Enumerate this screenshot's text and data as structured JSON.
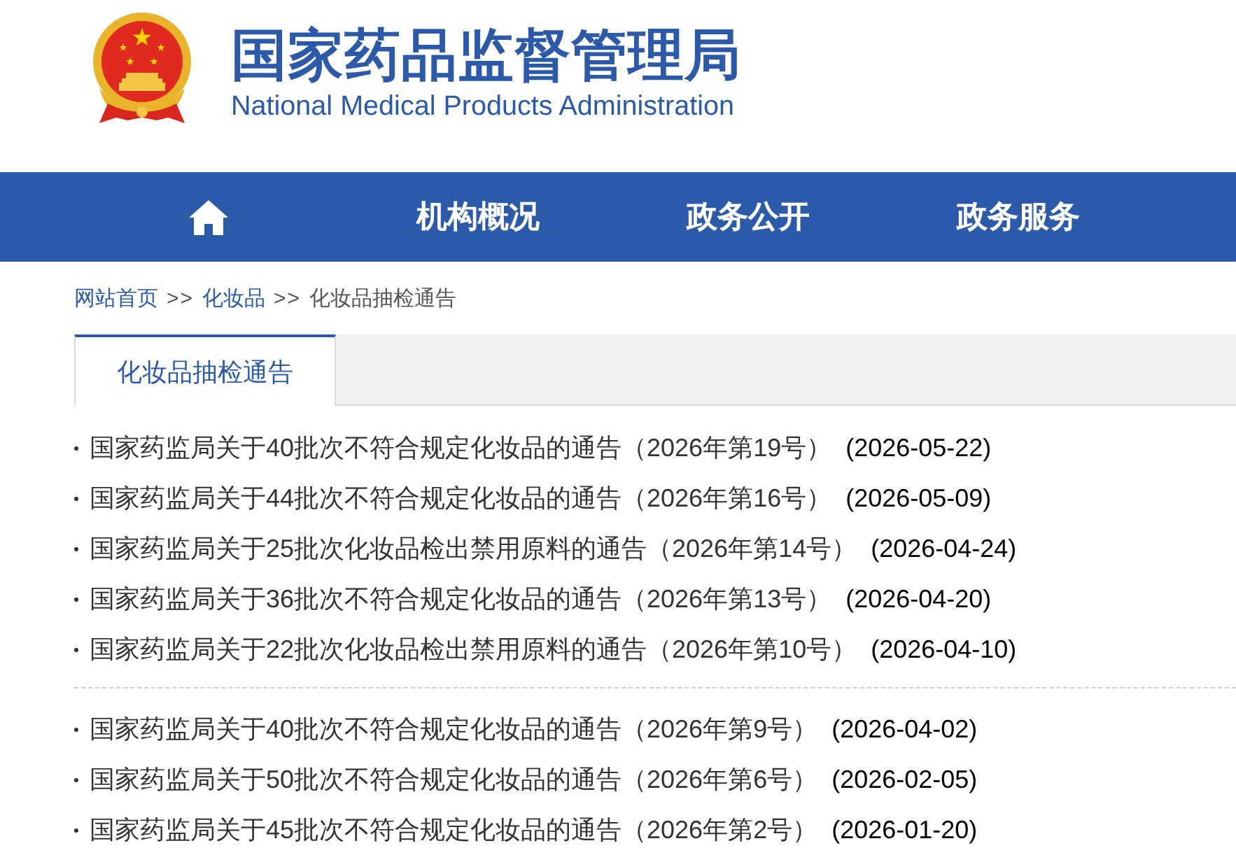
{
  "header": {
    "title": "国家药品监督管理局",
    "subtitle": "National Medical Products Administration"
  },
  "nav": [
    {
      "kind": "home"
    },
    {
      "kind": "text",
      "label": "机构概况"
    },
    {
      "kind": "text",
      "label": "政务公开"
    },
    {
      "kind": "text",
      "label": "政务服务"
    }
  ],
  "breadcrumb": [
    {
      "kind": "link",
      "text": "网站首页"
    },
    {
      "kind": "separator",
      "text": ">>"
    },
    {
      "kind": "link",
      "text": "化妆品"
    },
    {
      "kind": "separator",
      "text": ">>"
    },
    {
      "kind": "current",
      "text": "化妆品抽检通告"
    }
  ],
  "tabs": [
    {
      "label": "化妆品抽检通告",
      "selected": true
    }
  ],
  "notice_groups": [
    {
      "items": [
        {
          "title": "国家药监局关于40批次不符合规定化妆品的通告（2026年第19号）",
          "date": "(2026-05-22)"
        },
        {
          "title": "国家药监局关于44批次不符合规定化妆品的通告（2026年第16号）",
          "date": "(2026-05-09)"
        },
        {
          "title": "国家药监局关于25批次化妆品检出禁用原料的通告（2026年第14号）",
          "date": "(2026-04-24)"
        },
        {
          "title": "国家药监局关于36批次不符合规定化妆品的通告（2026年第13号）",
          "date": "(2026-04-20)"
        },
        {
          "title": "国家药监局关于22批次化妆品检出禁用原料的通告（2026年第10号）",
          "date": "(2026-04-10)"
        }
      ]
    },
    {
      "items": [
        {
          "title": "国家药监局关于40批次不符合规定化妆品的通告（2026年第9号）",
          "date": "(2026-04-02)"
        },
        {
          "title": "国家药监局关于50批次不符合规定化妆品的通告（2026年第6号）",
          "date": "(2026-02-05)"
        },
        {
          "title": "国家药监局关于45批次不符合规定化妆品的通告（2026年第2号）",
          "date": "(2026-01-20)"
        }
      ]
    }
  ]
}
